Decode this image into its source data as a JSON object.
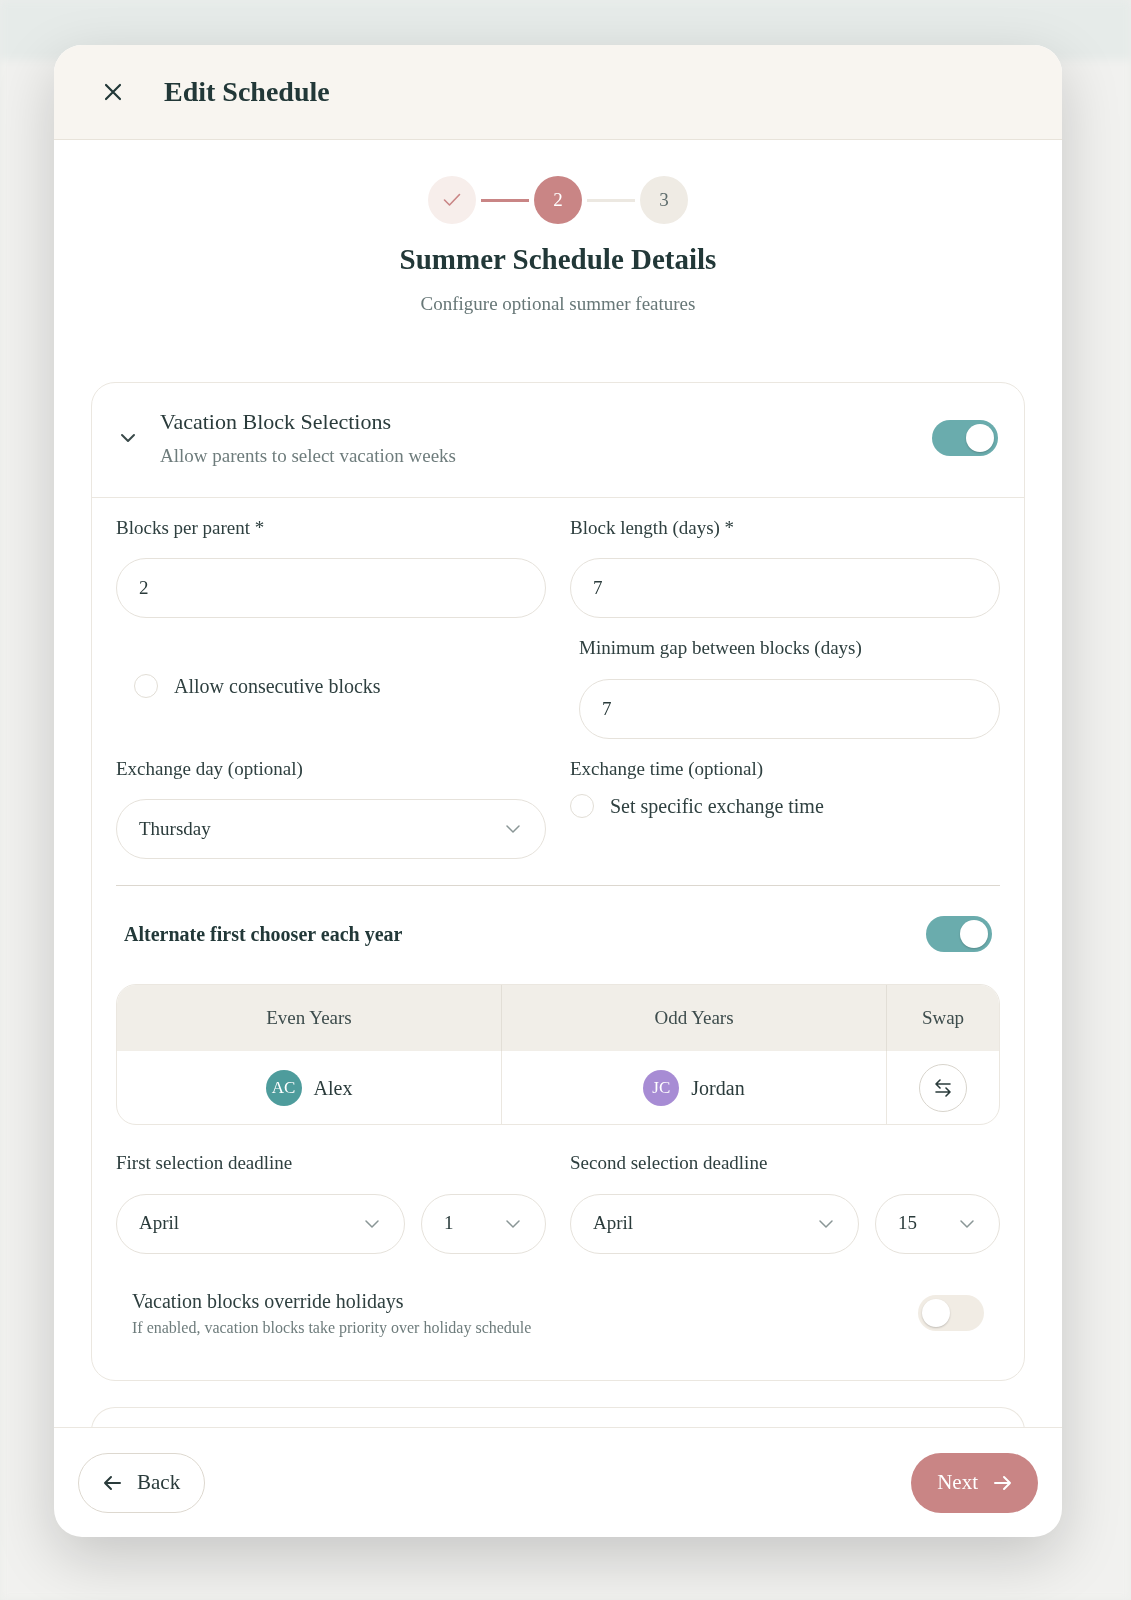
{
  "dialog": {
    "title": "Edit Schedule"
  },
  "stepper": [
    {
      "completed": true,
      "selected": false
    },
    {
      "label": "2",
      "completed": false,
      "selected": true
    },
    {
      "label": "3",
      "completed": false,
      "selected": false
    }
  ],
  "heading": "Summer Schedule Details",
  "subheading": "Configure optional summer features",
  "section": {
    "title": "Vacation Block Selections",
    "subtitle": "Allow parents to select vacation weeks",
    "expanded": true,
    "on": true
  },
  "blocks_per_parent": {
    "label": "Blocks per parent *",
    "value": "2"
  },
  "block_length": {
    "label": "Block length (days) *",
    "value": "7"
  },
  "allow_consecutive": {
    "label": "Allow consecutive blocks",
    "checked": false
  },
  "min_gap": {
    "label": "Minimum gap between blocks (days)",
    "value": "7"
  },
  "exchange_day": {
    "label": "Exchange day (optional)",
    "value": "Thursday"
  },
  "exchange_time": {
    "label": "Exchange time (optional)",
    "option": "Set specific exchange time",
    "checked": false
  },
  "alternate": {
    "label": "Alternate first chooser each year",
    "on": true
  },
  "chooser_table": {
    "columns": [
      "Even Years",
      "Odd Years",
      "Swap"
    ],
    "rows": [
      {
        "even": {
          "initials": "AC",
          "name": "Alex",
          "color": "#4e9c9c"
        },
        "odd": {
          "initials": "JC",
          "name": "Jordan",
          "color": "#a78cd4"
        }
      }
    ]
  },
  "first_deadline": {
    "label": "First selection deadline",
    "month": "April",
    "day": "1"
  },
  "second_deadline": {
    "label": "Second selection deadline",
    "month": "April",
    "day": "15"
  },
  "override": {
    "label": "Vacation blocks override holidays",
    "hint": "If enabled, vacation blocks take priority over holiday schedule",
    "on": false
  },
  "footer": {
    "back": "Back",
    "next": "Next"
  }
}
